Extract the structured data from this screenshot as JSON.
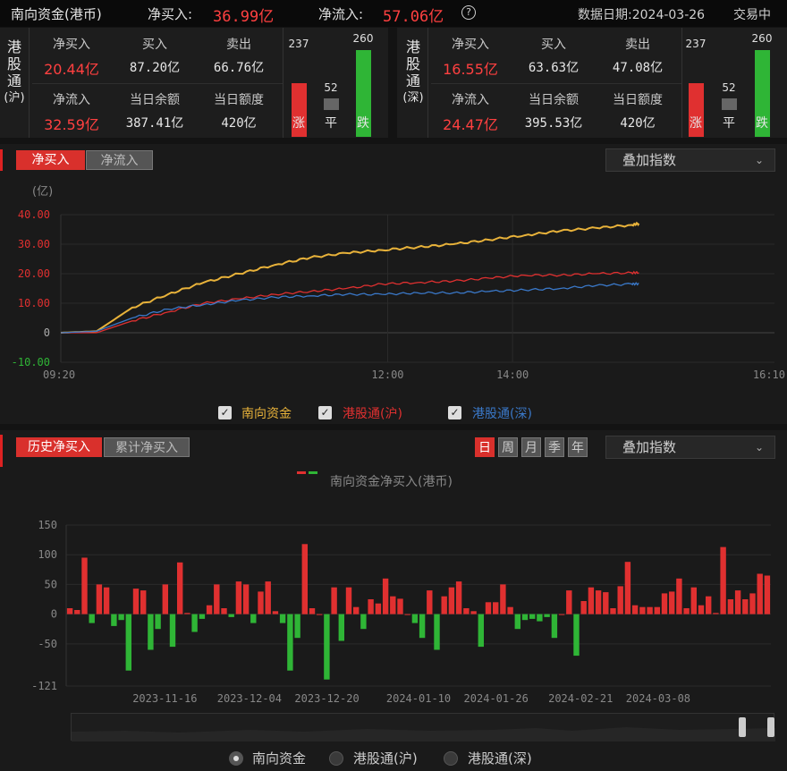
{
  "header": {
    "title": "南向资金(港币)",
    "net_buy_label": "净买入:",
    "net_buy_value": "36.99亿",
    "net_inflow_label": "净流入:",
    "net_inflow_value": "57.06亿",
    "help_icon": "?",
    "date_label": "数据日期:2024-03-26",
    "status": "交易中"
  },
  "panels": [
    {
      "name": "港股通(沪)",
      "vlabel": [
        "港",
        "股",
        "通",
        "(沪)"
      ],
      "row1": {
        "l1": "净买入",
        "v1": "20.44亿",
        "l2": "买入",
        "v2": "87.20亿",
        "l3": "卖出",
        "v3": "66.76亿"
      },
      "row2": {
        "l1": "净流入",
        "v1": "32.59亿",
        "l2": "当日余额",
        "v2": "387.41亿",
        "l3": "当日额度",
        "v3": "420亿"
      },
      "up": 237,
      "flat": 52,
      "down": 260,
      "up_label": "涨",
      "flat_label": "平",
      "down_label": "跌"
    },
    {
      "name": "港股通(深)",
      "vlabel": [
        "港",
        "股",
        "通",
        "(深)"
      ],
      "row1": {
        "l1": "净买入",
        "v1": "16.55亿",
        "l2": "买入",
        "v2": "63.63亿",
        "l3": "卖出",
        "v3": "47.08亿"
      },
      "row2": {
        "l1": "净流入",
        "v1": "24.47亿",
        "l2": "当日余额",
        "v2": "395.53亿",
        "l3": "当日额度",
        "v3": "420亿"
      },
      "up": 237,
      "flat": 52,
      "down": 260,
      "up_label": "涨",
      "flat_label": "平",
      "down_label": "跌"
    }
  ],
  "intraday": {
    "tab_active": "净买入",
    "tab_inactive": "净流入",
    "dropdown": "叠加指数",
    "unit": "(亿)",
    "legend": [
      "南向资金",
      "港股通(沪)",
      "港股通(深)"
    ]
  },
  "history": {
    "tab_active": "历史净买入",
    "tab_inactive": "累计净买入",
    "periods": [
      "日",
      "周",
      "月",
      "季",
      "年"
    ],
    "active_period": "日",
    "dropdown": "叠加指数",
    "legend_title": "南向资金净买入(港币)",
    "radios": [
      "南向资金",
      "港股通(沪)",
      "港股通(深)"
    ]
  },
  "colors": {
    "south": "#e8b23a",
    "sh": "#e03030",
    "sz": "#3a78c8",
    "up": "#e03030",
    "down": "#2fb536",
    "flat": "#666666"
  },
  "chart_data": [
    {
      "type": "line",
      "x_ticks": [
        "09:20",
        "12:00",
        "14:00",
        "16:10"
      ],
      "y_ticks": [
        "40.00",
        "30.00",
        "20.00",
        "10.00",
        "0",
        "-10.00"
      ],
      "ylabel": "(亿)",
      "ylim": [
        -10,
        40
      ],
      "x": [
        0,
        0.05,
        0.1,
        0.15,
        0.2,
        0.25,
        0.3,
        0.35,
        0.4,
        0.45,
        0.5,
        0.55,
        0.6,
        0.65,
        0.7,
        0.75,
        0.8,
        0.81
      ],
      "series": [
        {
          "name": "南向资金",
          "values": [
            0,
            0.5,
            8.5,
            13,
            17,
            20,
            23,
            25.5,
            27,
            28,
            29,
            30,
            31.5,
            33,
            34.5,
            35.5,
            36.5,
            37
          ]
        },
        {
          "name": "港股通(沪)",
          "values": [
            0,
            0,
            4,
            7,
            10,
            11.5,
            13,
            14,
            15,
            16.5,
            17,
            17.5,
            18.5,
            19.5,
            19.5,
            20,
            20.3,
            20.4
          ]
        },
        {
          "name": "港股通(深)",
          "values": [
            0,
            0.5,
            5,
            8,
            9.5,
            11,
            12,
            12.5,
            13,
            13,
            13.5,
            13.5,
            14,
            14.5,
            15,
            16,
            16.5,
            16.6
          ]
        }
      ],
      "grid": true,
      "legend": "bottom"
    },
    {
      "type": "bar",
      "title": "南向资金净买入(港币)",
      "y_ticks": [
        "150",
        "100",
        "50",
        "0",
        "-50",
        "-121"
      ],
      "ylim": [
        -121,
        150
      ],
      "x_ticks": [
        "2023-11-16",
        "2023-12-04",
        "2023-12-20",
        "2024-01-10",
        "2024-01-26",
        "2024-02-21",
        "2024-03-08"
      ],
      "values": [
        10,
        7,
        95,
        -15,
        50,
        45,
        -20,
        -10,
        -95,
        43,
        40,
        -60,
        -25,
        50,
        -55,
        87,
        2,
        -30,
        -8,
        15,
        50,
        10,
        -5,
        55,
        50,
        -15,
        38,
        55,
        5,
        -15,
        -95,
        -40,
        118,
        10,
        0,
        -110,
        45,
        -45,
        45,
        12,
        -25,
        25,
        18,
        60,
        30,
        26,
        0,
        -15,
        -40,
        40,
        -60,
        30,
        45,
        55,
        10,
        5,
        -55,
        20,
        20,
        50,
        12,
        -25,
        -10,
        -8,
        -12,
        -5,
        -40,
        0,
        40,
        -70,
        22,
        45,
        40,
        37,
        10,
        47,
        88,
        15,
        12,
        12,
        12,
        35,
        38,
        60,
        10,
        45,
        15,
        30,
        2,
        113,
        25,
        40,
        25,
        35,
        68,
        65
      ],
      "legend": "top"
    }
  ]
}
